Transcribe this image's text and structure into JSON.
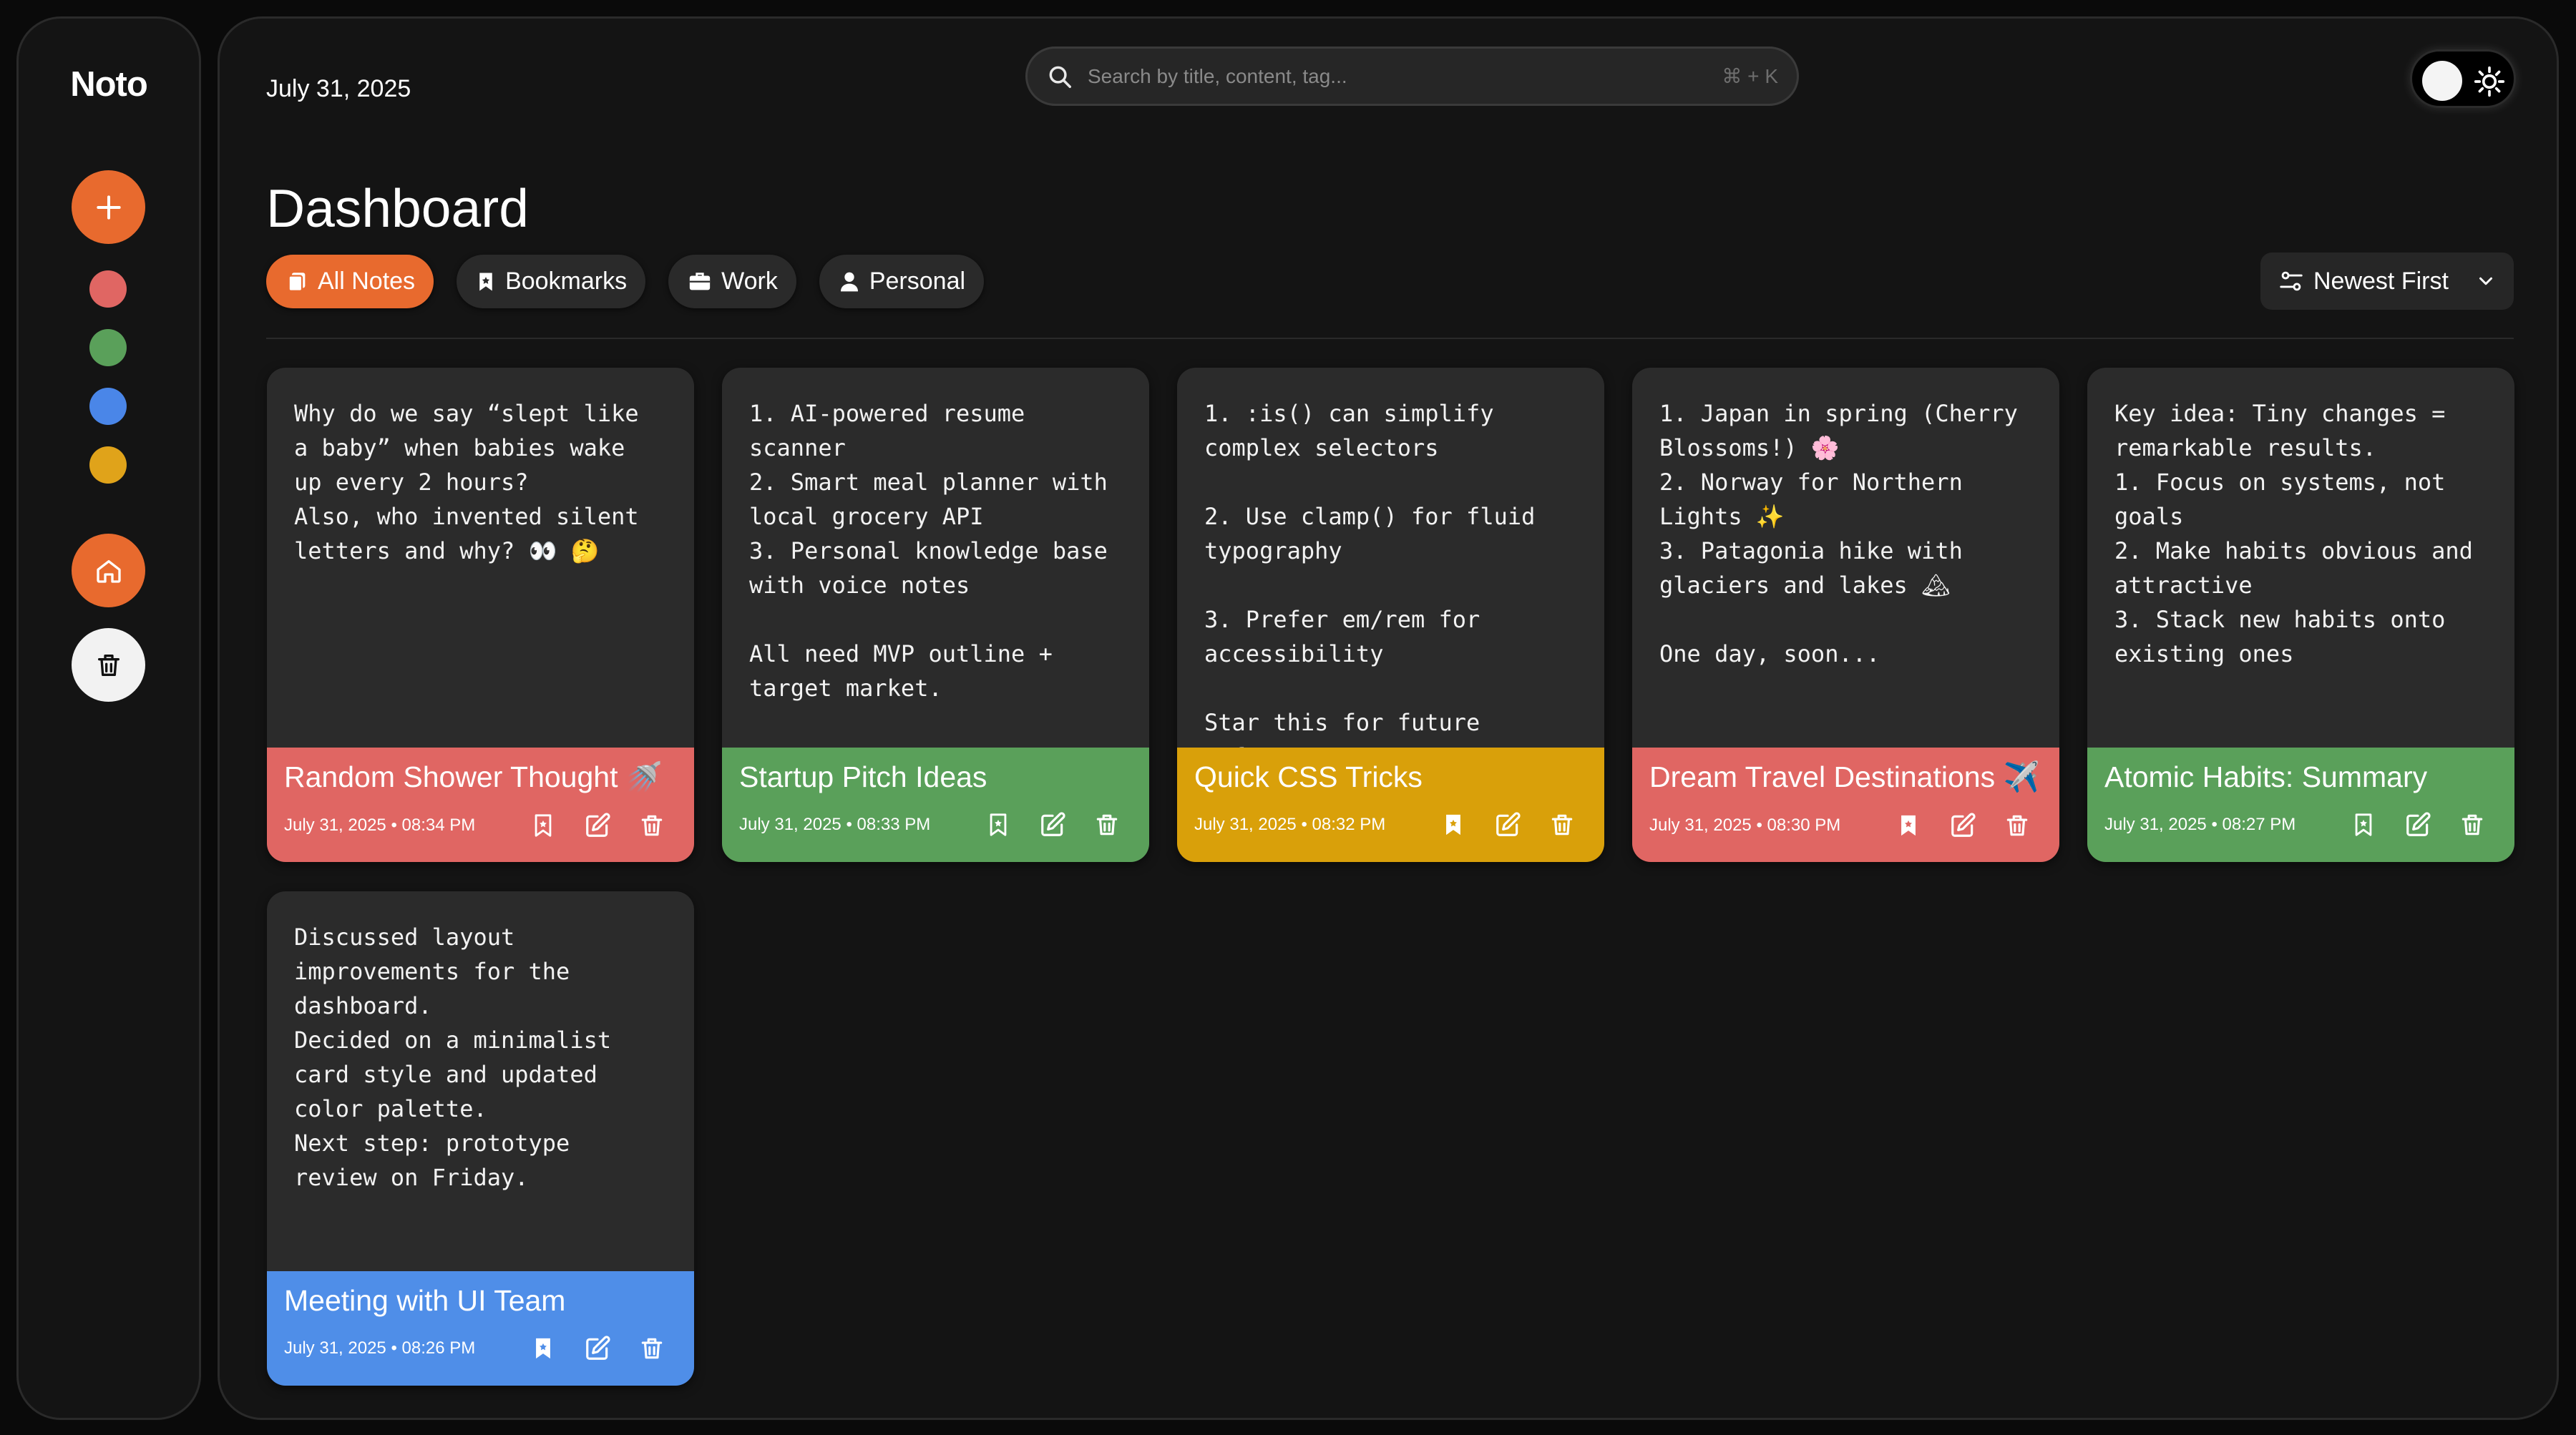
{
  "app": {
    "name": "Noto"
  },
  "sidebar": {
    "color_dots": [
      "#e06663",
      "#5aa05a",
      "#4a86e8",
      "#e0a31a"
    ]
  },
  "header": {
    "date": "July 31, 2025",
    "search_placeholder": "Search by title, content, tag...",
    "search_shortcut": "⌘ + K",
    "theme_toggle": "light-mode-toggle"
  },
  "page": {
    "title": "Dashboard"
  },
  "filters": [
    {
      "label": "All Notes",
      "icon": "notes-icon",
      "active": true
    },
    {
      "label": "Bookmarks",
      "icon": "bookmark-icon",
      "active": false
    },
    {
      "label": "Work",
      "icon": "briefcase-icon",
      "active": false
    },
    {
      "label": "Personal",
      "icon": "person-icon",
      "active": false
    }
  ],
  "sort": {
    "label": "Newest First"
  },
  "notes": [
    {
      "title": "Random Shower Thought 🚿",
      "date": "July 31, 2025 • 08:34 PM",
      "color": "#e06663",
      "bookmarked": false,
      "content": "Why do we say “slept like\na baby” when babies wake\nup every 2 hours?\nAlso, who invented silent\nletters and why? 👀 🤔"
    },
    {
      "title": "Startup Pitch Ideas",
      "date": "July 31, 2025 • 08:33 PM",
      "color": "#5aa05a",
      "bookmarked": false,
      "content": "1. AI-powered resume\nscanner\n2. Smart meal planner with\nlocal grocery API\n3. Personal knowledge base\nwith voice notes\n\nAll need MVP outline +\ntarget market."
    },
    {
      "title": "Quick CSS Tricks",
      "date": "July 31, 2025 • 08:32 PM",
      "color": "#d9a00a",
      "bookmarked": true,
      "content": "1. :is() can simplify\ncomplex selectors\n\n2. Use clamp() for fluid\ntypography\n\n3. Prefer em/rem for\naccessibility\n\nStar this for future\nreference."
    },
    {
      "title": "Dream Travel Destinations ✈️",
      "date": "July 31, 2025 • 08:30 PM",
      "color": "#e06663",
      "bookmarked": true,
      "content": "1. Japan in spring (Cherry\nBlossoms!) 🌸\n2. Norway for Northern\nLights ✨\n3. Patagonia hike with\nglaciers and lakes 🏔\n\nOne day, soon..."
    },
    {
      "title": "Atomic Habits: Summary",
      "date": "July 31, 2025 • 08:27 PM",
      "color": "#5aa05a",
      "bookmarked": false,
      "content": "Key idea: Tiny changes =\nremarkable results.\n1. Focus on systems, not\ngoals\n2. Make habits obvious and\nattractive\n3. Stack new habits onto\nexisting ones"
    },
    {
      "title": "Meeting with UI Team",
      "date": "July 31, 2025 • 08:26 PM",
      "color": "#4f8ee8",
      "bookmarked": true,
      "content": "Discussed layout\nimprovements for the\ndashboard.\nDecided on a minimalist\ncard style and updated\ncolor palette.\nNext step: prototype\nreview on Friday."
    }
  ]
}
